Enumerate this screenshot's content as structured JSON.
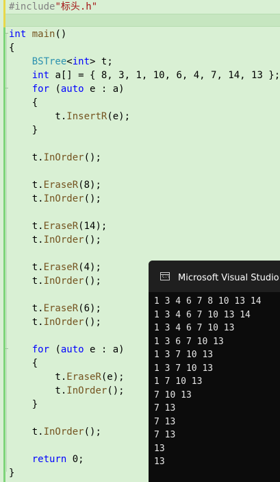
{
  "editor": {
    "lines": [
      [
        {
          "c": "pp",
          "t": "#include"
        },
        {
          "c": "str",
          "t": "\"标头.h\""
        }
      ],
      [],
      [
        {
          "c": "kw",
          "t": "int"
        },
        {
          "c": "plain",
          "t": " "
        },
        {
          "c": "fn",
          "t": "main"
        },
        {
          "c": "plain",
          "t": "()"
        }
      ],
      [
        {
          "c": "plain",
          "t": "{"
        }
      ],
      [
        {
          "c": "plain",
          "t": "    "
        },
        {
          "c": "ty",
          "t": "BSTree"
        },
        {
          "c": "plain",
          "t": "<"
        },
        {
          "c": "kw",
          "t": "int"
        },
        {
          "c": "plain",
          "t": "> t;"
        }
      ],
      [
        {
          "c": "plain",
          "t": "    "
        },
        {
          "c": "kw",
          "t": "int"
        },
        {
          "c": "plain",
          "t": " a[] = { 8, 3, 1, 10, 6, 4, 7, 14, 13 };"
        }
      ],
      [
        {
          "c": "plain",
          "t": "    "
        },
        {
          "c": "kw",
          "t": "for"
        },
        {
          "c": "plain",
          "t": " ("
        },
        {
          "c": "kw",
          "t": "auto"
        },
        {
          "c": "plain",
          "t": " e : a)"
        }
      ],
      [
        {
          "c": "plain",
          "t": "    {"
        }
      ],
      [
        {
          "c": "plain",
          "t": "        t."
        },
        {
          "c": "fn",
          "t": "InsertR"
        },
        {
          "c": "plain",
          "t": "(e);"
        }
      ],
      [
        {
          "c": "plain",
          "t": "    }"
        }
      ],
      [],
      [
        {
          "c": "plain",
          "t": "    t."
        },
        {
          "c": "fn",
          "t": "InOrder"
        },
        {
          "c": "plain",
          "t": "();"
        }
      ],
      [],
      [
        {
          "c": "plain",
          "t": "    t."
        },
        {
          "c": "fn",
          "t": "EraseR"
        },
        {
          "c": "plain",
          "t": "(8);"
        }
      ],
      [
        {
          "c": "plain",
          "t": "    t."
        },
        {
          "c": "fn",
          "t": "InOrder"
        },
        {
          "c": "plain",
          "t": "();"
        }
      ],
      [],
      [
        {
          "c": "plain",
          "t": "    t."
        },
        {
          "c": "fn",
          "t": "EraseR"
        },
        {
          "c": "plain",
          "t": "(14);"
        }
      ],
      [
        {
          "c": "plain",
          "t": "    t."
        },
        {
          "c": "fn",
          "t": "InOrder"
        },
        {
          "c": "plain",
          "t": "();"
        }
      ],
      [],
      [
        {
          "c": "plain",
          "t": "    t."
        },
        {
          "c": "fn",
          "t": "EraseR"
        },
        {
          "c": "plain",
          "t": "(4);"
        }
      ],
      [
        {
          "c": "plain",
          "t": "    t."
        },
        {
          "c": "fn",
          "t": "InOrder"
        },
        {
          "c": "plain",
          "t": "();"
        }
      ],
      [],
      [
        {
          "c": "plain",
          "t": "    t."
        },
        {
          "c": "fn",
          "t": "EraseR"
        },
        {
          "c": "plain",
          "t": "(6);"
        }
      ],
      [
        {
          "c": "plain",
          "t": "    t."
        },
        {
          "c": "fn",
          "t": "InOrder"
        },
        {
          "c": "plain",
          "t": "();"
        }
      ],
      [],
      [
        {
          "c": "plain",
          "t": "    "
        },
        {
          "c": "kw",
          "t": "for"
        },
        {
          "c": "plain",
          "t": " ("
        },
        {
          "c": "kw",
          "t": "auto"
        },
        {
          "c": "plain",
          "t": " e : a)"
        }
      ],
      [
        {
          "c": "plain",
          "t": "    {"
        }
      ],
      [
        {
          "c": "plain",
          "t": "        t."
        },
        {
          "c": "fn",
          "t": "EraseR"
        },
        {
          "c": "plain",
          "t": "(e);"
        }
      ],
      [
        {
          "c": "plain",
          "t": "        t."
        },
        {
          "c": "fn",
          "t": "InOrder"
        },
        {
          "c": "plain",
          "t": "();"
        }
      ],
      [
        {
          "c": "plain",
          "t": "    }"
        }
      ],
      [],
      [
        {
          "c": "plain",
          "t": "    t."
        },
        {
          "c": "fn",
          "t": "InOrder"
        },
        {
          "c": "plain",
          "t": "();"
        }
      ],
      [],
      [
        {
          "c": "plain",
          "t": "    "
        },
        {
          "c": "kw",
          "t": "return"
        },
        {
          "c": "plain",
          "t": " 0;"
        }
      ],
      [
        {
          "c": "plain",
          "t": "}"
        }
      ]
    ]
  },
  "console": {
    "title": "Microsoft Visual Studio 调",
    "output": [
      "1 3 4 6 7 8 10 13 14",
      "1 3 4 6 7 10 13 14",
      "1 3 4 6 7 10 13",
      "1 3 6 7 10 13",
      "1 3 7 10 13",
      "1 3 7 10 13",
      "1 7 10 13",
      "7 10 13",
      "7 13",
      "7 13",
      "7 13",
      "13",
      "13"
    ]
  },
  "colors": {
    "editor_bg": "#d9f0d4",
    "keyword": "#0000ff",
    "type": "#2b91af",
    "function": "#74531f",
    "string": "#a31515",
    "console_bg": "#0c0c0c"
  }
}
